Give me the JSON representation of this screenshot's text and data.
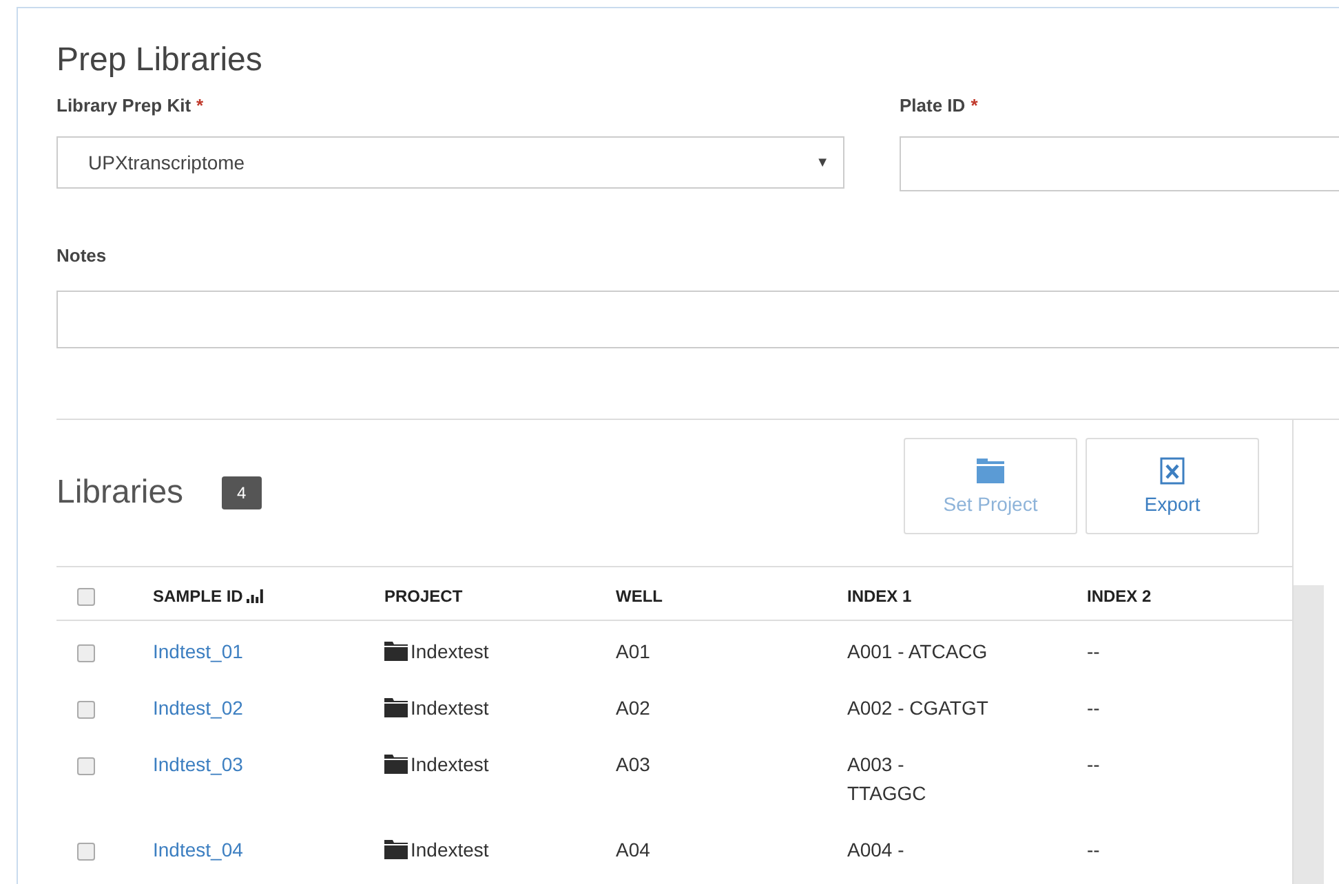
{
  "title": "Prep Libraries",
  "fields": {
    "kit": {
      "label": "Library Prep Kit",
      "required_mark": "*",
      "value": "UPXtranscriptome",
      "arrow": "▼"
    },
    "plate": {
      "label": "Plate ID",
      "required_mark": "*"
    },
    "notes": {
      "label": "Notes"
    }
  },
  "libraries": {
    "title": "Libraries",
    "count": "4",
    "buttons": [
      {
        "label": "Set Project",
        "disabled": true,
        "kind": "folder"
      },
      {
        "label": "Export",
        "disabled": false,
        "kind": "excel"
      }
    ],
    "table": {
      "select_all_checked": false,
      "columns": [
        "SAMPLE ID",
        "PROJECT",
        "WELL",
        "INDEX 1",
        "INDEX 2"
      ],
      "rows": [
        {
          "checked": false,
          "sample_id": "Indtest_01",
          "project": "Indextest",
          "well": "A01",
          "index_1": "A001 - ATCACG",
          "index_2": "--"
        },
        {
          "checked": false,
          "sample_id": "Indtest_02",
          "project": "Indextest",
          "well": "A02",
          "index_1": "A002 - CGATGT",
          "index_2": "--"
        },
        {
          "checked": false,
          "sample_id": "Indtest_03",
          "project": "Indextest",
          "well": "A03",
          "index_1": "A003 -\nTTAGGC",
          "index_2": "--"
        },
        {
          "checked": false,
          "sample_id": "Indtest_04",
          "project": "Indextest",
          "well": "A04",
          "index_1": "A004 -",
          "index_2": "--"
        }
      ]
    }
  }
}
